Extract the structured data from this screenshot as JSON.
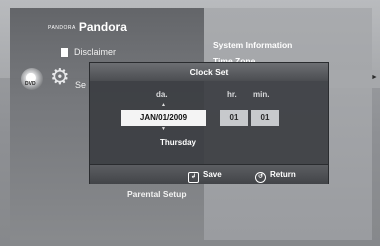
{
  "app": {
    "pandora_brand_small": "PANDORA",
    "pandora_label": "Pandora"
  },
  "menu": {
    "disclaimer": "Disclaimer",
    "setup_partial": "Se",
    "parental_setup": "Parental Setup",
    "disc_label": "DVD"
  },
  "submenu": {
    "system_information": "System Information",
    "time_zone": "Time Zone"
  },
  "dialog": {
    "title": "Clock Set",
    "labels": {
      "date": "da.",
      "hour": "hr.",
      "minute": "min."
    },
    "date_value": "JAN/01/2009",
    "hour_value": "01",
    "minute_value": "01",
    "day_of_week": "Thursday",
    "footer": {
      "save_label": "Save",
      "return_label": "Return"
    }
  },
  "icons": {
    "up_arrow": "▲",
    "down_arrow": "▼",
    "right_arrow": "►",
    "gear": "⚙",
    "save": "↲",
    "return": "↺"
  },
  "colors": {
    "dialog_bg": "#3a3c40",
    "selected_field": "#f4f4f4",
    "field_bg": "#c7c9cc",
    "text": "#ffffff"
  }
}
